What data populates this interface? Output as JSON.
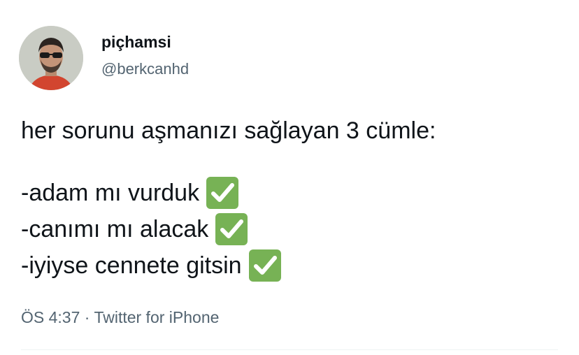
{
  "tweet": {
    "author": {
      "display_name": "piçhamsi",
      "handle": "@berkcanhd"
    },
    "text": {
      "intro": "her sorunu aşmanızı sağlayan 3 cümle:",
      "items": [
        {
          "text": "-adam mı vurduk",
          "icon": "check-mark-button-icon"
        },
        {
          "text": "-canımı mı alacak",
          "icon": "check-mark-button-icon"
        },
        {
          "text": "-iyiyse cennete gitsin",
          "icon": "check-mark-button-icon"
        }
      ]
    },
    "meta": {
      "time": "ÖS 4:37",
      "separator": "·",
      "source": "Twitter for iPhone"
    }
  },
  "colors": {
    "check_green": "#77b255",
    "secondary_text": "#536471",
    "primary_text": "#0f1419"
  }
}
